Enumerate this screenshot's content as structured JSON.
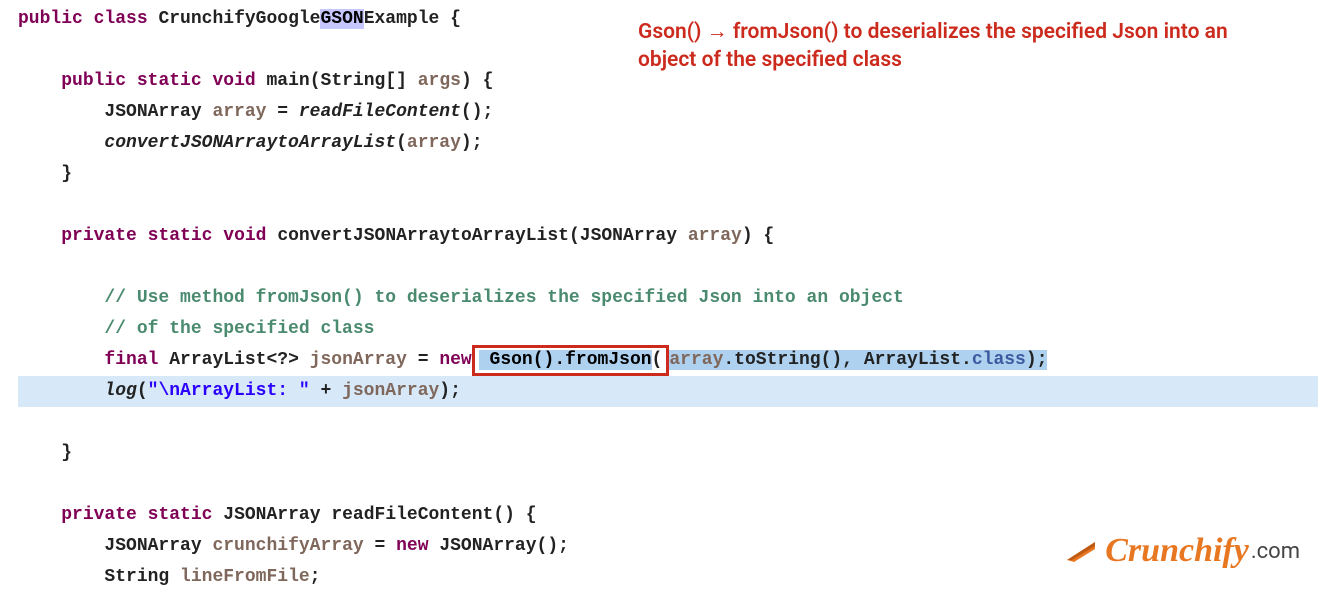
{
  "annotation": "Gson() → fromJson() to deserializes the specified Json into an object of the specified class",
  "logo": {
    "brand": "Crunchify",
    "suffix": ".com"
  },
  "code": {
    "l1": {
      "kw1": "public",
      "kw2": "class",
      "name_a": "CrunchifyGoogle",
      "name_hl": "GSON",
      "name_b": "Example",
      "brace": " {"
    },
    "l3": {
      "kw1": "public",
      "kw2": "static",
      "kw3": "void",
      "fn": "main",
      "sig": "(String[] ",
      "arg": "args",
      "end": ") {"
    },
    "l4": {
      "typ": "JSONArray",
      "var": "array",
      "eq": " = ",
      "call": "readFileContent",
      "par": "();"
    },
    "l5": {
      "call": "convertJSONArraytoArrayList",
      "open": "(",
      "arg": "array",
      "close": ");"
    },
    "l6": {
      "brace": "}"
    },
    "l8": {
      "kw1": "private",
      "kw2": "static",
      "kw3": "void",
      "fn": "convertJSONArraytoArrayList",
      "open": "(",
      "typ": "JSONArray",
      "arg": "array",
      "end": ") {"
    },
    "l10": {
      "c": "// Use method fromJson() to deserializes the specified Json into an object"
    },
    "l11": {
      "c": "// of the specified class"
    },
    "l12": {
      "kw1": "final",
      "typ": "ArrayList<?>",
      "var": "jsonArray",
      "eq": " = ",
      "kw2": "new",
      "box": "Gson().fromJson(",
      "arg": "array",
      "m1": ".toString(), ",
      "typ2": "ArrayList.",
      "fld": "class",
      "end": ");",
      "text_sel": " Gson().fromJson"
    },
    "l13": {
      "call": "log",
      "open": "(",
      "str": "\"\\nArrayList: \"",
      "plus": " + ",
      "var": "jsonArray",
      "end": ");"
    },
    "l15": {
      "brace": "}"
    },
    "l17": {
      "kw1": "private",
      "kw2": "static",
      "typ": "JSONArray",
      "fn": "readFileContent",
      "end": "() {"
    },
    "l18": {
      "typ": "JSONArray",
      "var": "crunchifyArray",
      "eq": " = ",
      "kw": "new",
      "call": "JSONArray();"
    },
    "l19": {
      "typ": "String",
      "var": "lineFromFile",
      "end": ";"
    }
  }
}
